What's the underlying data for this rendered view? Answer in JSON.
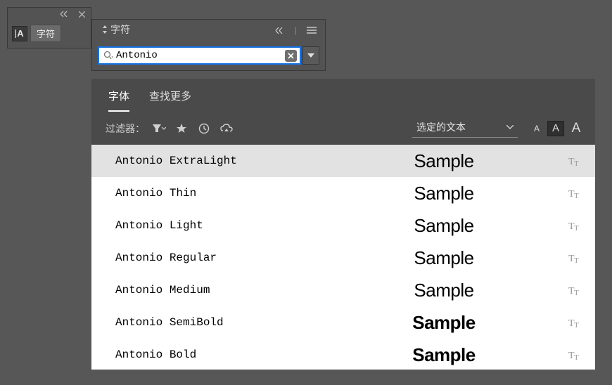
{
  "mini_panel": {
    "title": "字符"
  },
  "panel": {
    "tab_title": "字符"
  },
  "search": {
    "value": "Antonio"
  },
  "tabs": {
    "fonts": "字体",
    "find_more": "查找更多"
  },
  "filter": {
    "label": "过滤器：",
    "preview_option": "选定的文本"
  },
  "fonts": [
    {
      "name": "Antonio ExtraLight",
      "sample": "Sample",
      "weight": "w200",
      "hover": true
    },
    {
      "name": "Antonio Thin",
      "sample": "Sample",
      "weight": "w100",
      "hover": false
    },
    {
      "name": "Antonio Light",
      "sample": "Sample",
      "weight": "w300",
      "hover": false
    },
    {
      "name": "Antonio Regular",
      "sample": "Sample",
      "weight": "w400",
      "hover": false
    },
    {
      "name": "Antonio Medium",
      "sample": "Sample",
      "weight": "w500",
      "hover": false
    },
    {
      "name": "Antonio SemiBold",
      "sample": "Sample",
      "weight": "w600",
      "hover": false
    },
    {
      "name": "Antonio Bold",
      "sample": "Sample",
      "weight": "w700",
      "hover": false
    }
  ]
}
